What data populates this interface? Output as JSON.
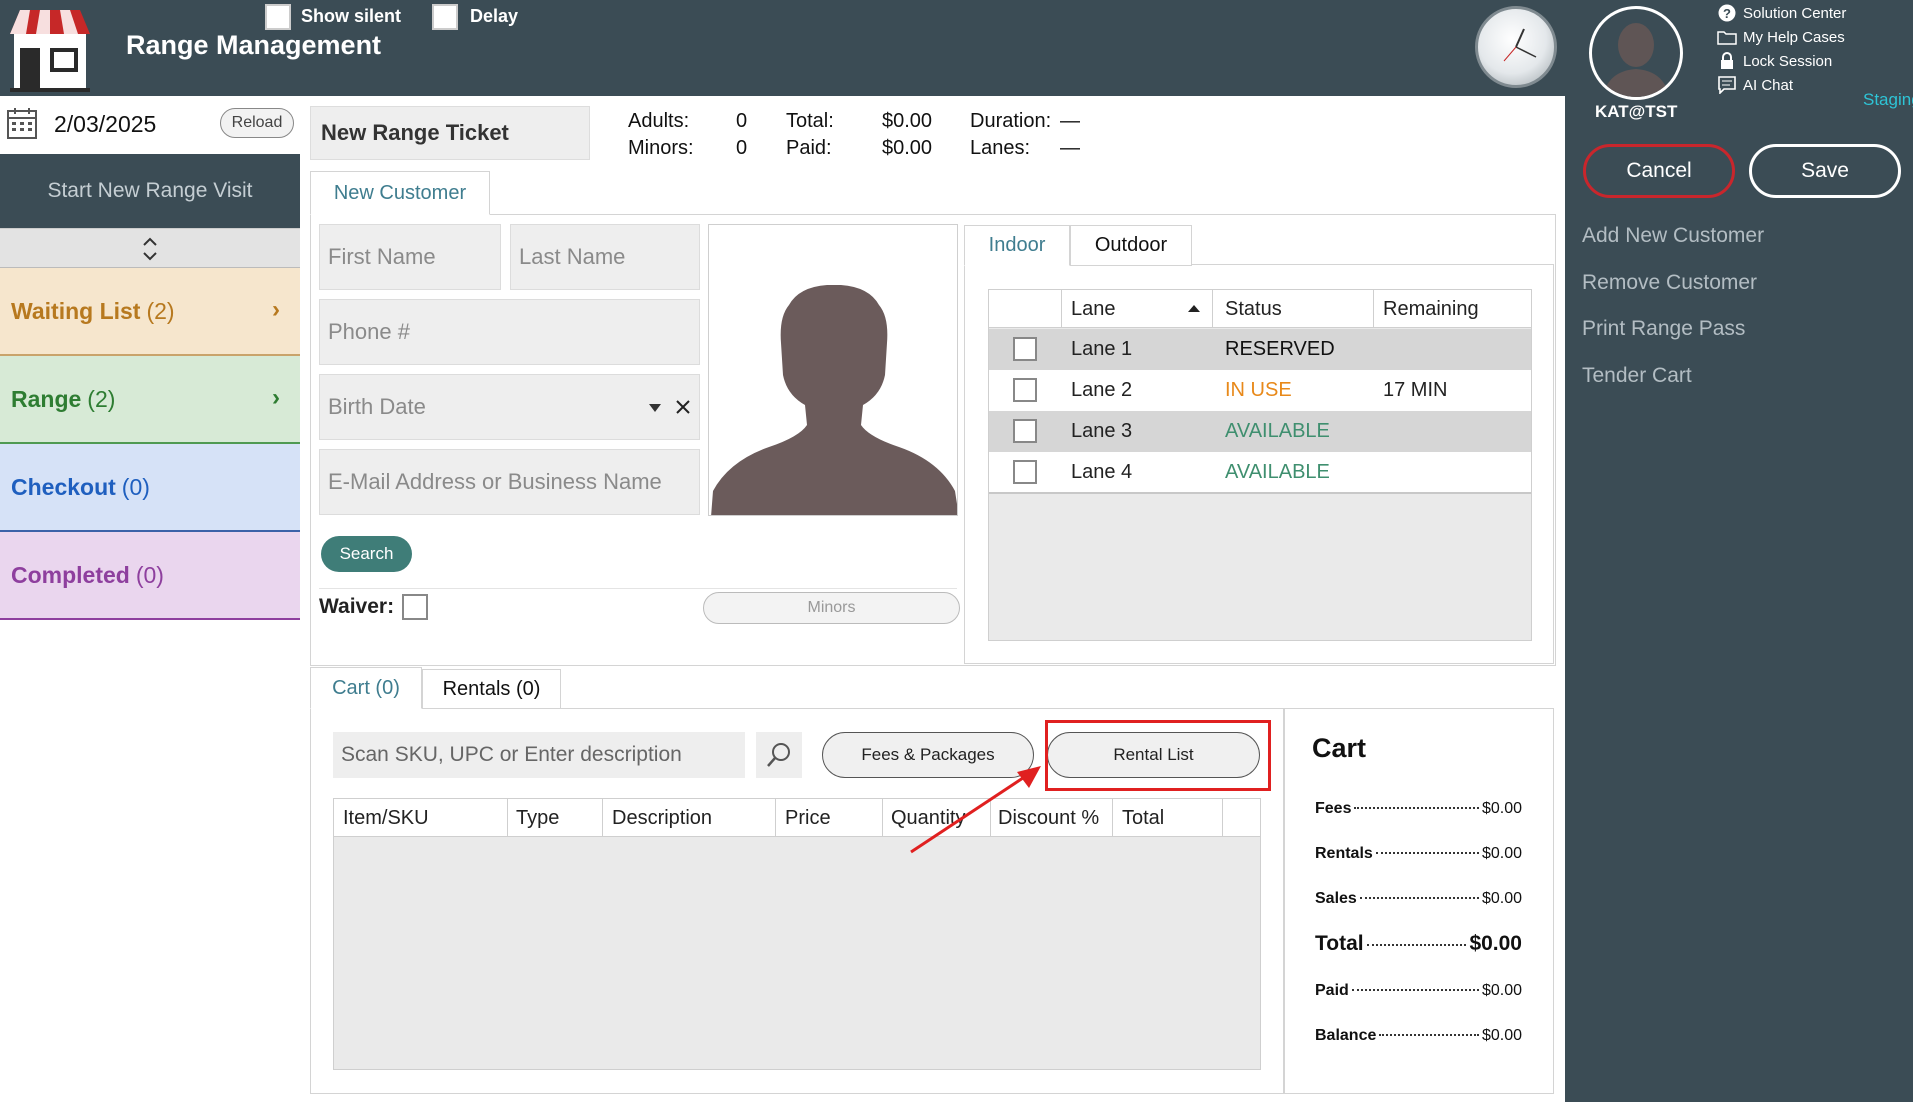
{
  "app": {
    "title": "Range Management",
    "show_silent_label": "Show silent",
    "delay_label": "Delay"
  },
  "user": {
    "name": "KAT@TST",
    "environment": "Staging"
  },
  "help_links": [
    "Solution Center",
    "My Help Cases",
    "Lock Session",
    "AI Chat"
  ],
  "actions": {
    "cancel": "Cancel",
    "save": "Save",
    "side_actions": [
      "Add New Customer",
      "Remove Customer",
      "Print Range Pass",
      "Tender Cart"
    ]
  },
  "sidebar": {
    "date": "2/03/2025",
    "reload": "Reload",
    "start_visit": "Start New Range Visit",
    "queues": [
      {
        "label": "Waiting List",
        "count": "(2)",
        "color": "#b7791f",
        "bg": "#f6e6cd",
        "border": "#c9a36a"
      },
      {
        "label": "Range",
        "count": "(2)",
        "color": "#2e7d32",
        "bg": "#d7ead6",
        "border": "#4f9a52"
      },
      {
        "label": "Checkout",
        "count": "(0)",
        "color": "#1f5fbf",
        "bg": "#d6e2f7",
        "border": "#3b62a8"
      },
      {
        "label": "Completed",
        "count": "(0)",
        "color": "#8e3f9e",
        "bg": "#ead6ee",
        "border": "#8e3f9e"
      }
    ]
  },
  "ticket": {
    "title": "New Range Ticket",
    "adults_label": "Adults:",
    "adults": "0",
    "minors_label": "Minors:",
    "minors": "0",
    "total_label": "Total:",
    "total": "$0.00",
    "paid_label": "Paid:",
    "paid": "$0.00",
    "duration_label": "Duration:",
    "duration": "—",
    "lanes_label": "Lanes:",
    "lanes": "—"
  },
  "customer": {
    "tab": "New Customer",
    "first_name_placeholder": "First Name",
    "last_name_placeholder": "Last Name",
    "phone_placeholder": "Phone #",
    "birth_date_placeholder": "Birth Date",
    "email_placeholder": "E-Mail Address or Business Name",
    "search": "Search",
    "waiver_label": "Waiver:",
    "minors_button": "Minors"
  },
  "lanes": {
    "tabs": [
      "Indoor",
      "Outdoor"
    ],
    "columns": [
      "Lane",
      "Status",
      "Remaining"
    ],
    "rows": [
      {
        "lane": "Lane 1",
        "status": "RESERVED",
        "remaining": "",
        "status_color": "#111111"
      },
      {
        "lane": "Lane 2",
        "status": "IN USE",
        "remaining": "17 MIN",
        "status_color": "#e8891a"
      },
      {
        "lane": "Lane 3",
        "status": "AVAILABLE",
        "remaining": "",
        "status_color": "#3f8f6f"
      },
      {
        "lane": "Lane 4",
        "status": "AVAILABLE",
        "remaining": "",
        "status_color": "#3f8f6f"
      }
    ]
  },
  "cart": {
    "tabs": [
      "Cart (0)",
      "Rentals (0)"
    ],
    "sku_placeholder": "Scan SKU, UPC or Enter description",
    "fees_button": "Fees & Packages",
    "rental_button": "Rental List",
    "columns": [
      "Item/SKU",
      "Type",
      "Description",
      "Price",
      "Quantity",
      "Discount %",
      "Total"
    ]
  },
  "summary": {
    "title": "Cart",
    "rows": [
      {
        "label": "Fees",
        "value": "$0.00"
      },
      {
        "label": "Rentals",
        "value": "$0.00"
      },
      {
        "label": "Sales",
        "value": "$0.00"
      },
      {
        "label": "Total",
        "value": "$0.00"
      },
      {
        "label": "Paid",
        "value": "$0.00"
      },
      {
        "label": "Balance",
        "value": "$0.00"
      }
    ]
  }
}
